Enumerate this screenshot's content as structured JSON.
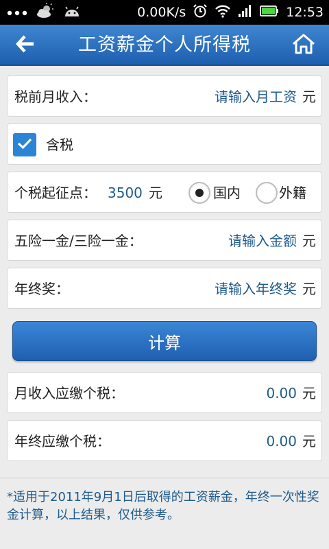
{
  "status_bar": {
    "speed": "0.00K/s",
    "time": "12:53",
    "icons": [
      "more-icon",
      "weather-icon",
      "android-icon",
      "alarm-icon",
      "wifi-icon",
      "signal-icon",
      "battery-icon"
    ]
  },
  "header": {
    "title": "工资薪金个人所得税",
    "back_icon": "back-arrow-icon",
    "home_icon": "home-icon"
  },
  "form": {
    "monthly_income": {
      "label": "税前月收入：",
      "placeholder": "请输入月工资",
      "unit": "元"
    },
    "tax_included": {
      "label": "含税",
      "checked": true
    },
    "threshold": {
      "label": "个税起征点：",
      "value": "3500",
      "unit": "元",
      "options": [
        {
          "label": "国内",
          "selected": true
        },
        {
          "label": "外籍",
          "selected": false
        }
      ]
    },
    "insurance": {
      "label": "五险一金/三险一金：",
      "placeholder": "请输入金额",
      "unit": "元"
    },
    "bonus": {
      "label": "年终奖：",
      "placeholder": "请输入年终奖",
      "unit": "元"
    }
  },
  "calculate_label": "计算",
  "results": {
    "monthly_tax": {
      "label": "月收入应缴个税：",
      "value": "0.00",
      "unit": "元"
    },
    "bonus_tax": {
      "label": "年终应缴个税：",
      "value": "0.00",
      "unit": "元"
    }
  },
  "note": "*适用于2011年9月1日后取得的工资薪金，年终一次性奖金计算，以上结果，仅供参考。",
  "colors": {
    "primary": "#2c6fc2",
    "value_text": "#1e5a8c",
    "background": "#ececec"
  }
}
